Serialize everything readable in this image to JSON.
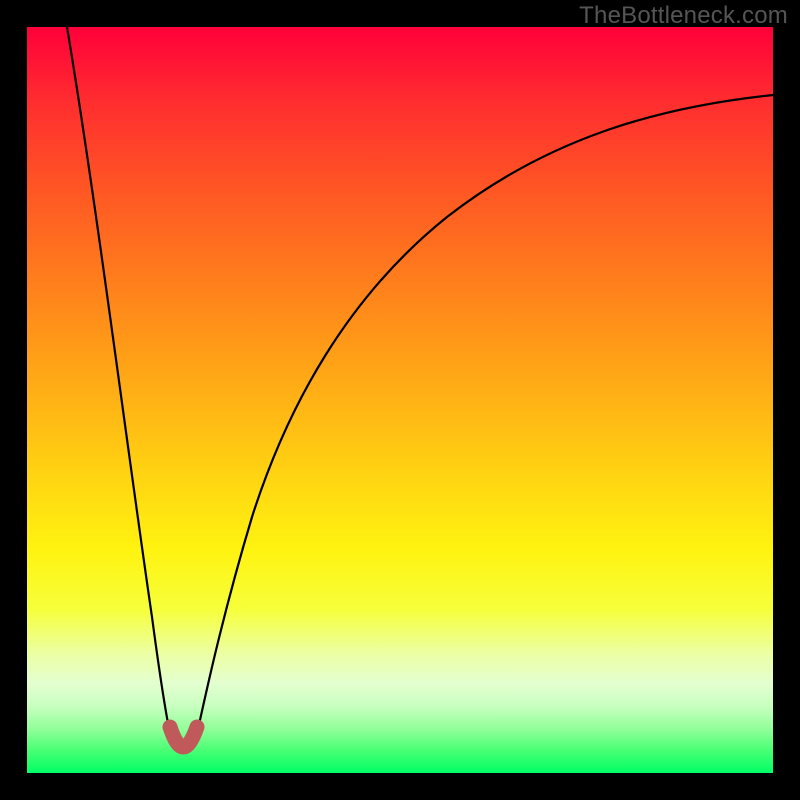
{
  "attribution": "TheBottleneck.com",
  "chart_data": {
    "type": "line",
    "title": "",
    "xlabel": "",
    "ylabel": "",
    "xlim": [
      0,
      100
    ],
    "ylim": [
      0,
      100
    ],
    "curve_description": "Bottleneck mismatch curve: y drops from ~100 at x≈5 to ~0 near x≈20, then rises asymptotically to ~90 at x=100",
    "x": [
      5,
      8,
      11,
      14,
      17,
      18.5,
      20,
      21.5,
      23,
      26,
      30,
      35,
      40,
      46,
      53,
      61,
      70,
      80,
      90,
      100
    ],
    "values": [
      100,
      81,
      62,
      42,
      20,
      8,
      2,
      8,
      17,
      30,
      42,
      52,
      59,
      66,
      72,
      77,
      81,
      85,
      88,
      90
    ],
    "optimum_marker": {
      "x": 20,
      "y": 2
    },
    "color_scale": {
      "top": "#ff003a",
      "bottom": "#00ff66",
      "meaning": "red = high bottleneck, green = low bottleneck"
    },
    "grid": false,
    "legend": false
  }
}
